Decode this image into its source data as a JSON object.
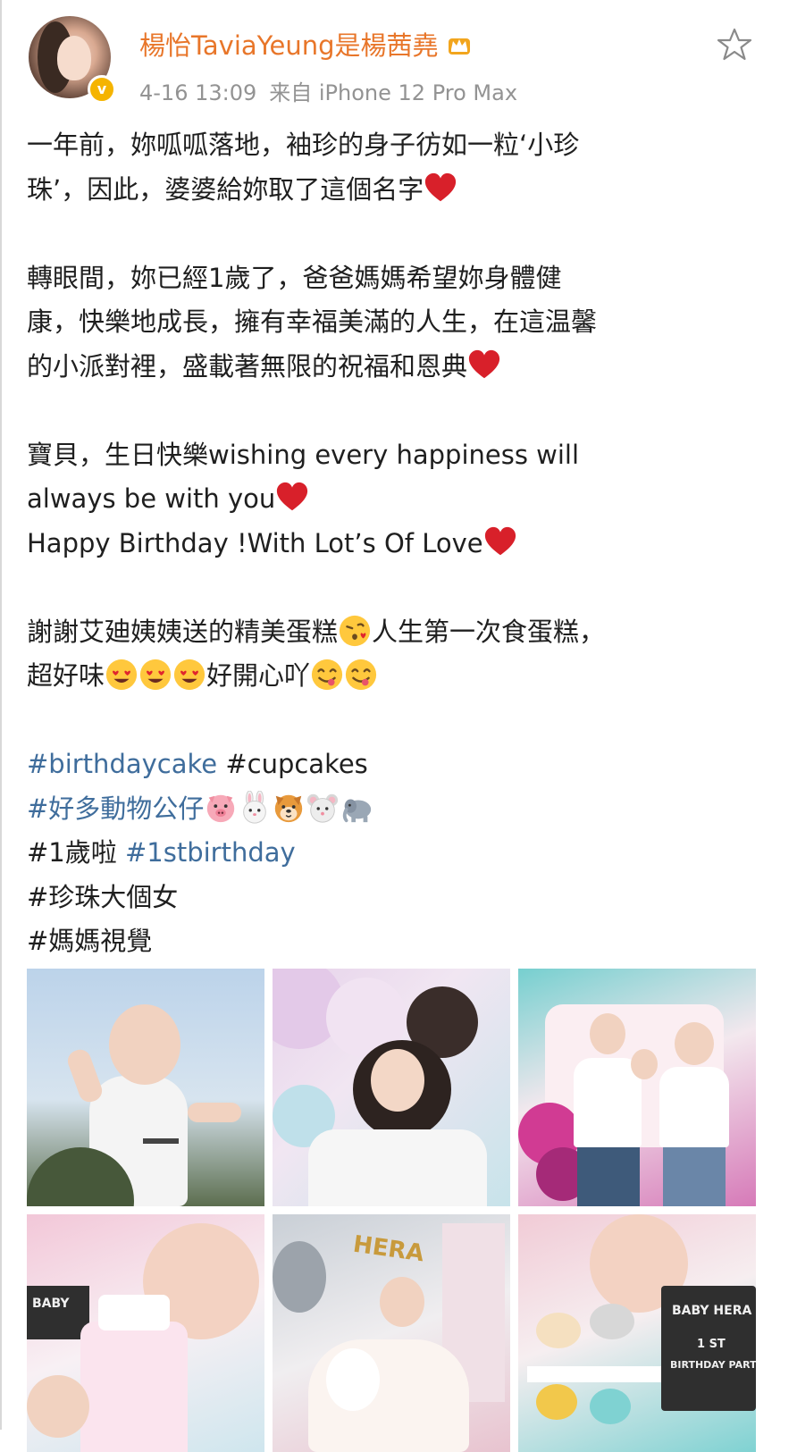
{
  "header": {
    "username": "楊怡TaviaYeung是楊茜堯",
    "timestamp": "4-16 13:09",
    "source": "来自 iPhone 12 Pro Max",
    "verified_icon": "verified-v-icon",
    "crown_icon": "crown-icon",
    "favorite_icon": "star-outline-icon"
  },
  "post": {
    "p1_line1": "一年前，妳呱呱落地，袖珍的身子彷如一粒‘小珍",
    "p1_line2": "珠’，因此，婆婆給妳取了這個名字",
    "p2_line1": "轉眼間，妳已經1歲了，爸爸媽媽希望妳身體健",
    "p2_line2": "康，快樂地成長，擁有幸福美滿的人生，在這温馨",
    "p2_line3": "的小派對裡，盛載著無限的祝福和恩典",
    "p3_line1": "寶貝，生日快樂wishing every happiness will",
    "p3_line2": "always be with you",
    "p3_line3": "Happy Birthday !With Lot’s Of Love",
    "p4_line1": "謝謝艾廸姨姨送的精美蛋糕",
    "p4_line1b": "人生第一次食蛋糕，",
    "p4_line2a": "超好味",
    "p4_line2b": "好開心吖"
  },
  "hashtags": {
    "tag1": "#birthdaycake",
    "tag2": "#cupcakes",
    "tag3": "#好多動物公仔",
    "tag4": "#1歲啦",
    "tag5": "#1stbirthday",
    "tag6": "#珍珠大個女",
    "tag7": "#媽媽視覺"
  },
  "photos": {
    "p4_text": "BABY",
    "p5_text": "HERA",
    "p6_text1": "BABY HERA",
    "p6_text2": "1 ST",
    "p6_text3": "BIRTHDAY PARTY"
  },
  "colors": {
    "username": "#e8762a",
    "meta": "#939393",
    "hashtag": "#3f6d9c",
    "heart": "#d8202a",
    "verified": "#f5b400"
  }
}
